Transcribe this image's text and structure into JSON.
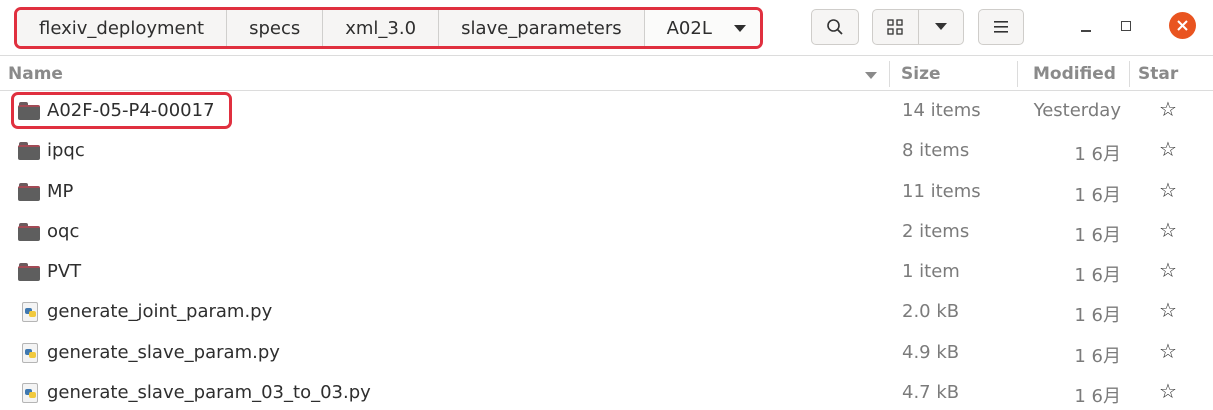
{
  "breadcrumb": {
    "items": [
      "flexiv_deployment",
      "specs",
      "xml_3.0",
      "slave_parameters",
      "A02L"
    ]
  },
  "toolbar": {
    "search_icon": "search-icon",
    "view_icon": "grid-view-icon",
    "view_dropdown_icon": "chevron-down-icon",
    "menu_icon": "hamburger-menu-icon"
  },
  "window": {
    "minimize_icon": "minimize-icon",
    "maximize_icon": "maximize-icon",
    "close_icon": "close-icon",
    "close_color": "#e95420"
  },
  "columns": {
    "name": "Name",
    "size": "Size",
    "modified": "Modified",
    "star": "Star"
  },
  "files": [
    {
      "name": "A02F-05-P4-00017",
      "type": "folder",
      "size": "14 items",
      "modified": "Yesterday",
      "star": "☆"
    },
    {
      "name": "ipqc",
      "type": "folder",
      "size": "8 items",
      "modified": "1 6月",
      "star": "☆"
    },
    {
      "name": "MP",
      "type": "folder",
      "size": "11 items",
      "modified": "1 6月",
      "star": "☆"
    },
    {
      "name": "oqc",
      "type": "folder",
      "size": "2 items",
      "modified": "1 6月",
      "star": "☆"
    },
    {
      "name": "PVT",
      "type": "folder",
      "size": "1 item",
      "modified": "1 6月",
      "star": "☆"
    },
    {
      "name": "generate_joint_param.py",
      "type": "python-file",
      "size": "2.0 kB",
      "modified": "1 6月",
      "star": "☆"
    },
    {
      "name": "generate_slave_param.py",
      "type": "python-file",
      "size": "4.9 kB",
      "modified": "1 6月",
      "star": "☆"
    },
    {
      "name": "generate_slave_param_03_to_03.py",
      "type": "python-file",
      "size": "4.7 kB",
      "modified": "1 6月",
      "star": "☆"
    }
  ],
  "colors": {
    "annotation_box": "#e0303f",
    "folder": "#5e5e5e"
  }
}
